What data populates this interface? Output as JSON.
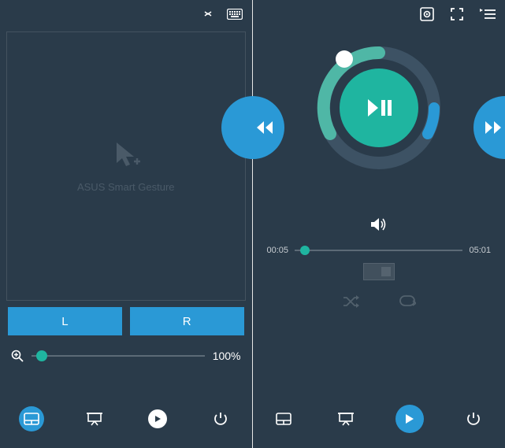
{
  "left": {
    "canvas_label": "ASUS Smart Gesture",
    "btn_left": "L",
    "btn_right": "R",
    "zoom_value": "100%",
    "zoom_position_pct": 6
  },
  "right": {
    "time_current": "00:05",
    "time_total": "05:01",
    "seek_position_pct": 6
  },
  "colors": {
    "accent_blue": "#2a99d6",
    "accent_teal": "#1fb5a0",
    "bg": "#2a3b4a"
  }
}
